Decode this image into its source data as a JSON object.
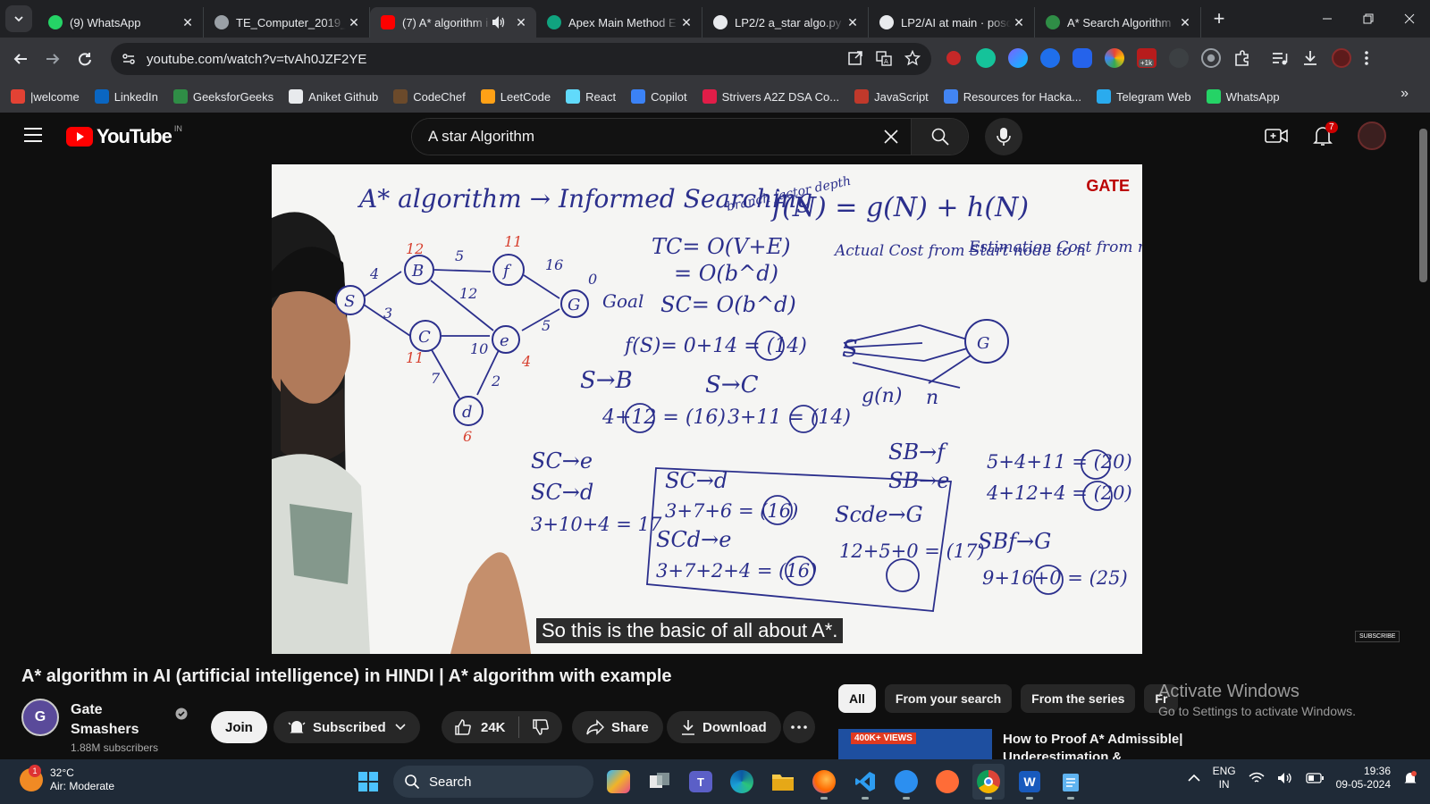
{
  "browser": {
    "tabs": [
      {
        "title": "(9) WhatsApp",
        "icon": "whatsapp-icon",
        "color": "#25d366"
      },
      {
        "title": "TE_Computer_2019_C",
        "icon": "globe-icon",
        "color": "#9aa0a6"
      },
      {
        "title": "(7) A* algorithm i",
        "icon": "youtube-icon",
        "color": "#ff0000",
        "active": true
      },
      {
        "title": "Apex Main Method E",
        "icon": "chatgpt-icon",
        "color": "#10a37f"
      },
      {
        "title": "LP2/2 a_star algo.py",
        "icon": "github-icon",
        "color": "#e8eaed"
      },
      {
        "title": "LP2/AI at main · posc",
        "icon": "github-icon",
        "color": "#e8eaed"
      },
      {
        "title": "A* Search Algorithm",
        "icon": "geeksforgeeks-icon",
        "color": "#2f8d46"
      }
    ],
    "url": "youtube.com/watch?v=tvAh0JZF2YE",
    "extension_badge": "+1k",
    "bookmarks": [
      {
        "label": "|welcome",
        "icon": "welcome-icon",
        "color": "#e34234"
      },
      {
        "label": "LinkedIn",
        "icon": "linkedin-icon",
        "color": "#0a66c2"
      },
      {
        "label": "GeeksforGeeks",
        "icon": "geeksforgeeks-icon",
        "color": "#2f8d46"
      },
      {
        "label": "Aniket Github",
        "icon": "github-icon",
        "color": "#e8eaed"
      },
      {
        "label": "CodeChef",
        "icon": "codechef-icon",
        "color": "#6b4a2b"
      },
      {
        "label": "LeetCode",
        "icon": "leetcode-icon",
        "color": "#ffa116"
      },
      {
        "label": "React",
        "icon": "react-icon",
        "color": "#61dafb"
      },
      {
        "label": "Copilot",
        "icon": "copilot-icon",
        "color": "#3b82f6"
      },
      {
        "label": "Strivers A2Z DSA Co...",
        "icon": "takeuforward-icon",
        "color": "#e11d48"
      },
      {
        "label": "JavaScript",
        "icon": "javascript-icon",
        "color": "#c0392b"
      },
      {
        "label": "Resources for Hacka...",
        "icon": "document-icon",
        "color": "#4285f4"
      },
      {
        "label": "Telegram Web",
        "icon": "telegram-icon",
        "color": "#2aabee"
      },
      {
        "label": "WhatsApp",
        "icon": "whatsapp-icon",
        "color": "#25d366"
      }
    ]
  },
  "youtube": {
    "logo_text": "YouTube",
    "country_code": "IN",
    "search_query": "A star Algorithm",
    "notification_count": "7",
    "caption": "So this is the basic of all about A*.",
    "video_title": "A* algorithm in AI (artificial intelligence) in HINDI | A* algorithm with example",
    "channel": {
      "name": "Gate Smashers",
      "subscribers": "1.88M subscribers"
    },
    "buttons": {
      "join": "Join",
      "subscribed": "Subscribed",
      "likes": "24K",
      "share": "Share",
      "download": "Download"
    },
    "chips": [
      "All",
      "From your search",
      "From the series",
      "Fr"
    ],
    "recommendation": {
      "title": "How to Proof A* Admissible| Underestimation &",
      "badge": "400K+ VIEWS"
    },
    "watermark": "GATE",
    "subscribe_watermark": "SUBSCRIBE"
  },
  "whiteboard": {
    "title": "A* algorithm → Informed Searching",
    "formula": "f(N) = g(N) + h(N)",
    "branch_note": "branch factor depth",
    "actual_cost": "Actual Cost from Start node to n",
    "estimation_cost": "Estimation Cost from n to Goal node",
    "tc": "TC= O(V+E)",
    "tc2": "= O(b^d)",
    "sc": "SC= O(b^d)",
    "fs": "f(S)= 0+14 = (14)",
    "sb": "S→B",
    "sb_calc": "4+12 = (16)",
    "sc_path": "S→C",
    "sc_calc": "3+11 = (14)",
    "sce": "SC→e",
    "scd": "SC→d",
    "scd_calc": "3+10+4 = 17",
    "box_scd": "SC→d",
    "box_scd_calc": "3+7+6 = (16)",
    "box_scde": "SCd→e",
    "box_scde_calc": "3+7+2+4 = (16)",
    "scdeg": "Scde→G",
    "scdeg_calc": "12+5+0 = (17)",
    "sbf": "SB→f",
    "sbe": "SB→e",
    "sbf_calc": "5+4+11 = (20)",
    "sbe_calc": "4+12+4 = (20)",
    "sbfg": "SBf→G",
    "sbfg_calc": "9+16+0 = (25)",
    "goal_label": "Goal",
    "start_label": "Start",
    "g_n": "g(n)",
    "n_label": "n"
  },
  "windows": {
    "activate_title": "Activate Windows",
    "activate_sub": "Go to Settings to activate Windows.",
    "weather_temp": "32°C",
    "weather_desc": "Air: Moderate",
    "weather_badge": "1",
    "taskbar_search": "Search",
    "lang_line1": "ENG",
    "lang_line2": "IN",
    "time": "19:36",
    "date": "09-05-2024"
  }
}
